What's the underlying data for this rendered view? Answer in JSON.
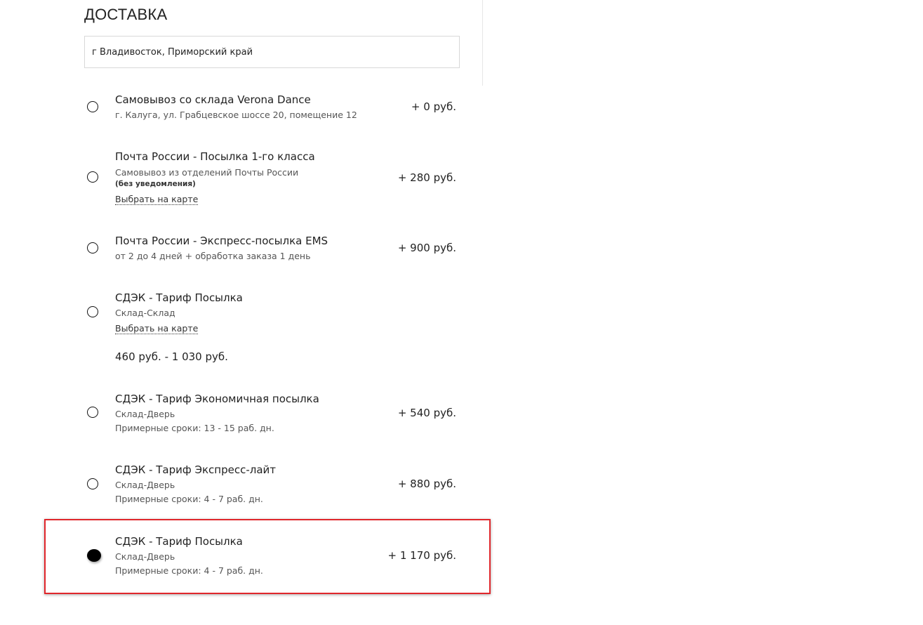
{
  "delivery": {
    "title": "ДОСТАВКА",
    "city_value": "г Владивосток, Приморский край",
    "options": [
      {
        "title": "Самовывоз со склада Verona Dance",
        "subtitle": "г. Калуга, ул. Грабцевское шоссе 20, помещение 12",
        "price": "+ 0 руб.",
        "selected": false
      },
      {
        "title": "Почта России - Посылка 1-го класса",
        "subtitle": "Самовывоз из отделений Почты России",
        "note": "(без уведомления)",
        "map_link": "Выбрать на карте",
        "price": "+ 280 руб.",
        "selected": false
      },
      {
        "title": "Почта России - Экспресс-посылка EMS",
        "subtitle": "от 2 до 4 дней + обработка заказа 1 день",
        "price": "+ 900 руб.",
        "selected": false
      },
      {
        "title": "СДЭК - Тариф Посылка",
        "subtitle": "Склад-Склад",
        "map_link": "Выбрать на карте",
        "price_range": "460 руб. - 1 030 руб.",
        "selected": false
      },
      {
        "title": "СДЭК - Тариф Экономичная посылка",
        "subtitle": "Склад-Дверь",
        "terms": "Примерные сроки: 13 - 15 раб. дн.",
        "price": "+ 540 руб.",
        "selected": false
      },
      {
        "title": "СДЭК - Тариф Экспресс-лайт",
        "subtitle": "Склад-Дверь",
        "terms": "Примерные сроки: 4 - 7 раб. дн.",
        "price": "+ 880 руб.",
        "selected": false
      },
      {
        "title": "СДЭК - Тариф Посылка",
        "subtitle": "Склад-Дверь",
        "terms": "Примерные сроки: 4 - 7 раб. дн.",
        "price": "+ 1 170 руб.",
        "selected": true
      }
    ]
  },
  "colors": {
    "highlight_border": "#e0262b",
    "text": "#222222",
    "muted_text": "#555555"
  }
}
